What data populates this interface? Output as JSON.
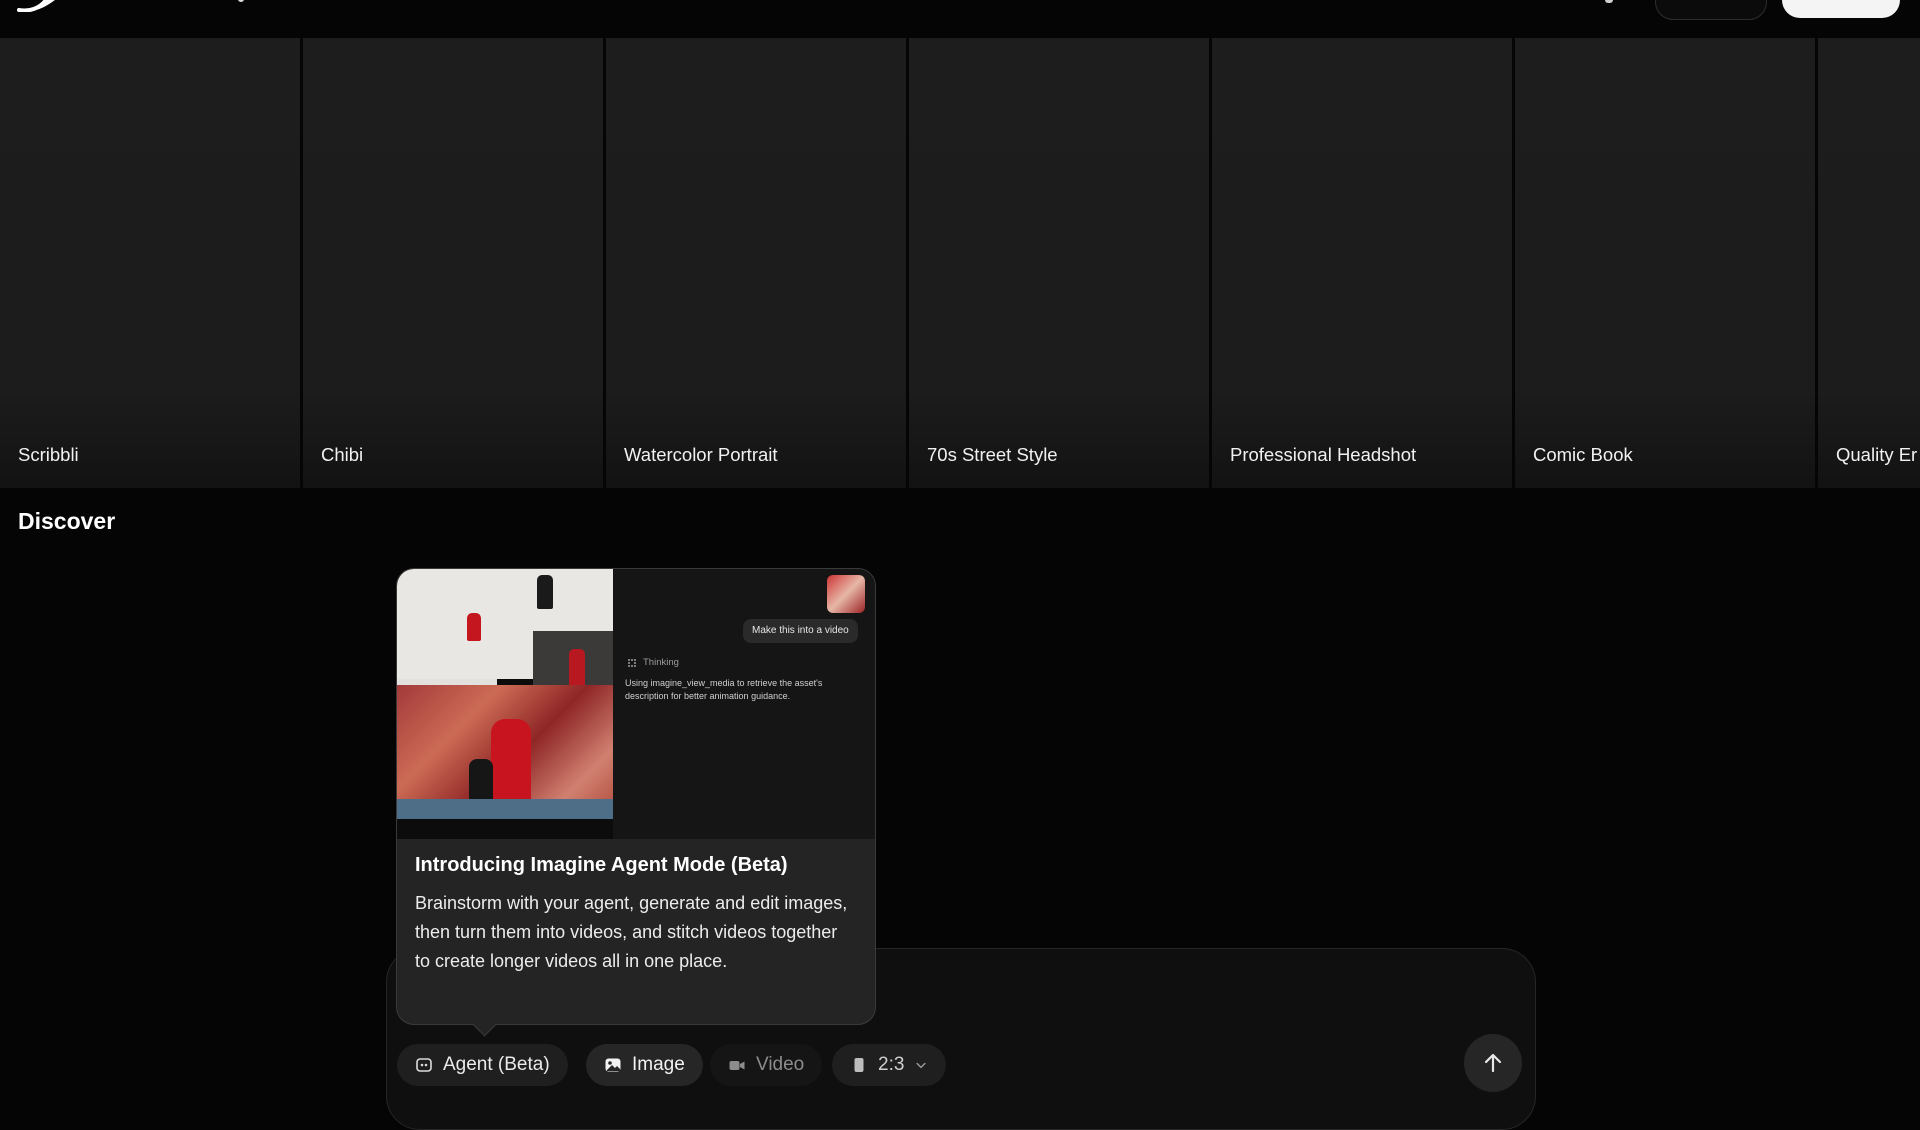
{
  "styles": [
    {
      "label": "Scribbli"
    },
    {
      "label": "Chibi"
    },
    {
      "label": "Watercolor Portrait"
    },
    {
      "label": "70s Street Style"
    },
    {
      "label": "Professional Headshot"
    },
    {
      "label": "Comic Book"
    },
    {
      "label": "Quality Er"
    }
  ],
  "discover": {
    "title": "Discover"
  },
  "popup": {
    "preview": {
      "message": "Make this into a video",
      "thinking_label": "Thinking",
      "thinking_note": "Using imagine_view_media to retrieve the asset's description for better animation guidance."
    },
    "title": "Introducing Imagine Agent Mode (Beta)",
    "body": "Brainstorm with your agent, generate and edit images, then turn them into videos, and stitch videos together to create longer videos all in one place."
  },
  "composer": {
    "modes": [
      {
        "label": "Agent (Beta)",
        "icon": "agent-icon"
      },
      {
        "label": "Image",
        "icon": "image-icon",
        "selected": true
      },
      {
        "label": "Video",
        "icon": "video-camera-icon"
      }
    ],
    "aspect_ratio": "2:3",
    "send_icon": "arrow-up-icon"
  },
  "colors": {
    "background": "#050505",
    "card": "#1d1d1d",
    "popup": "#242424",
    "chip": "#1f1f1f",
    "accent_red": "#c8141e"
  }
}
